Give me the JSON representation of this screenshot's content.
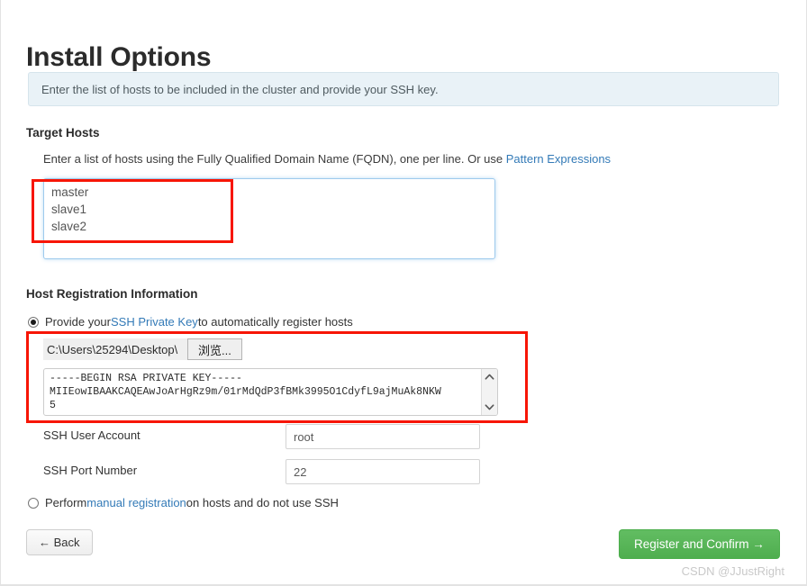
{
  "page": {
    "title": "Install Options",
    "info_banner": "Enter the list of hosts to be included in the cluster and provide your SSH key.",
    "watermark": "CSDN @JJustRight"
  },
  "target_hosts": {
    "heading": "Target Hosts",
    "helper_text_before": "Enter a list of hosts using the Fully Qualified Domain Name (FQDN), one per line. Or use ",
    "helper_link": "Pattern Expressions",
    "hosts_value": "master\nslave1\nslave2",
    "hosts_placeholder": ""
  },
  "host_registration": {
    "heading": "Host Registration Information",
    "ssh_option": {
      "selected": true,
      "text_before": "Provide your ",
      "link": "SSH Private Key",
      "text_after": " to automatically register hosts"
    },
    "file_chooser": {
      "path_value": "C:\\Users\\25294\\Desktop\\",
      "browse_label": "浏览..."
    },
    "private_key_value": "-----BEGIN RSA PRIVATE KEY-----\nMIIEowIBAAKCAQEAwJoArHgRz9m/01rMdQdP3fBMk3995O1CdyfL9ajMuAk8NKW\n5",
    "scroll_up_icon": "chevron-up-icon",
    "scroll_down_icon": "chevron-down-icon",
    "fields": [
      {
        "label": "SSH User Account",
        "value": "root"
      },
      {
        "label": "SSH Port Number",
        "value": "22"
      }
    ],
    "manual_option": {
      "selected": false,
      "text_before": "Perform ",
      "link": "manual registration",
      "text_after": " on hosts and do not use SSH"
    }
  },
  "footer": {
    "back_label": "← Back",
    "register_label": "Register and Confirm →"
  },
  "annotations": {
    "accent_color": "#f71505",
    "boxes": [
      "target-hosts-highlight",
      "private-key-highlight"
    ]
  }
}
